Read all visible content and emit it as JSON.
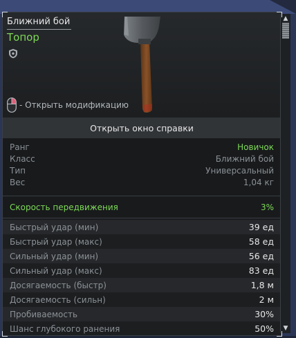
{
  "item": {
    "category": "Ближний бой",
    "name": "Топор"
  },
  "mod_hint": "- Открыть модификацию",
  "help_button": "Открыть окно справки",
  "info": [
    {
      "label": "Ранг",
      "value": "Новичок",
      "highlight": true
    },
    {
      "label": "Класс",
      "value": "Ближний бой",
      "highlight": false
    },
    {
      "label": "Тип",
      "value": "Универсальный",
      "highlight": false
    },
    {
      "label": "Вес",
      "value": "1,04 кг",
      "highlight": false
    }
  ],
  "speed": {
    "label": "Скорость передвижения",
    "value": "3%"
  },
  "stats": [
    {
      "label": "Быстрый удар (мин)",
      "value": "39 ед"
    },
    {
      "label": "Быстрый удар (макс)",
      "value": "58 ед"
    },
    {
      "label": "Сильный удар (мин)",
      "value": "56 ед"
    },
    {
      "label": "Сильный удар (макс)",
      "value": "83 ед"
    },
    {
      "label": "Досягаемость (быстр)",
      "value": "1,8 м"
    },
    {
      "label": "Досягаемость (сильн)",
      "value": "2 м"
    },
    {
      "label": "Пробиваемость",
      "value": "30%"
    },
    {
      "label": "Шанс глубокого ранения",
      "value": "50%"
    }
  ],
  "colors": {
    "accent_green": "#7ed957",
    "panel_bg": "#181a1c",
    "outer_bg": "#2b3656"
  },
  "icons": {
    "shield": "shield-icon",
    "mouse": "mouse-right-click-icon",
    "axe": "axe-image",
    "scroll_up": "chevron-up-icon",
    "scroll_down": "chevron-down-icon"
  }
}
